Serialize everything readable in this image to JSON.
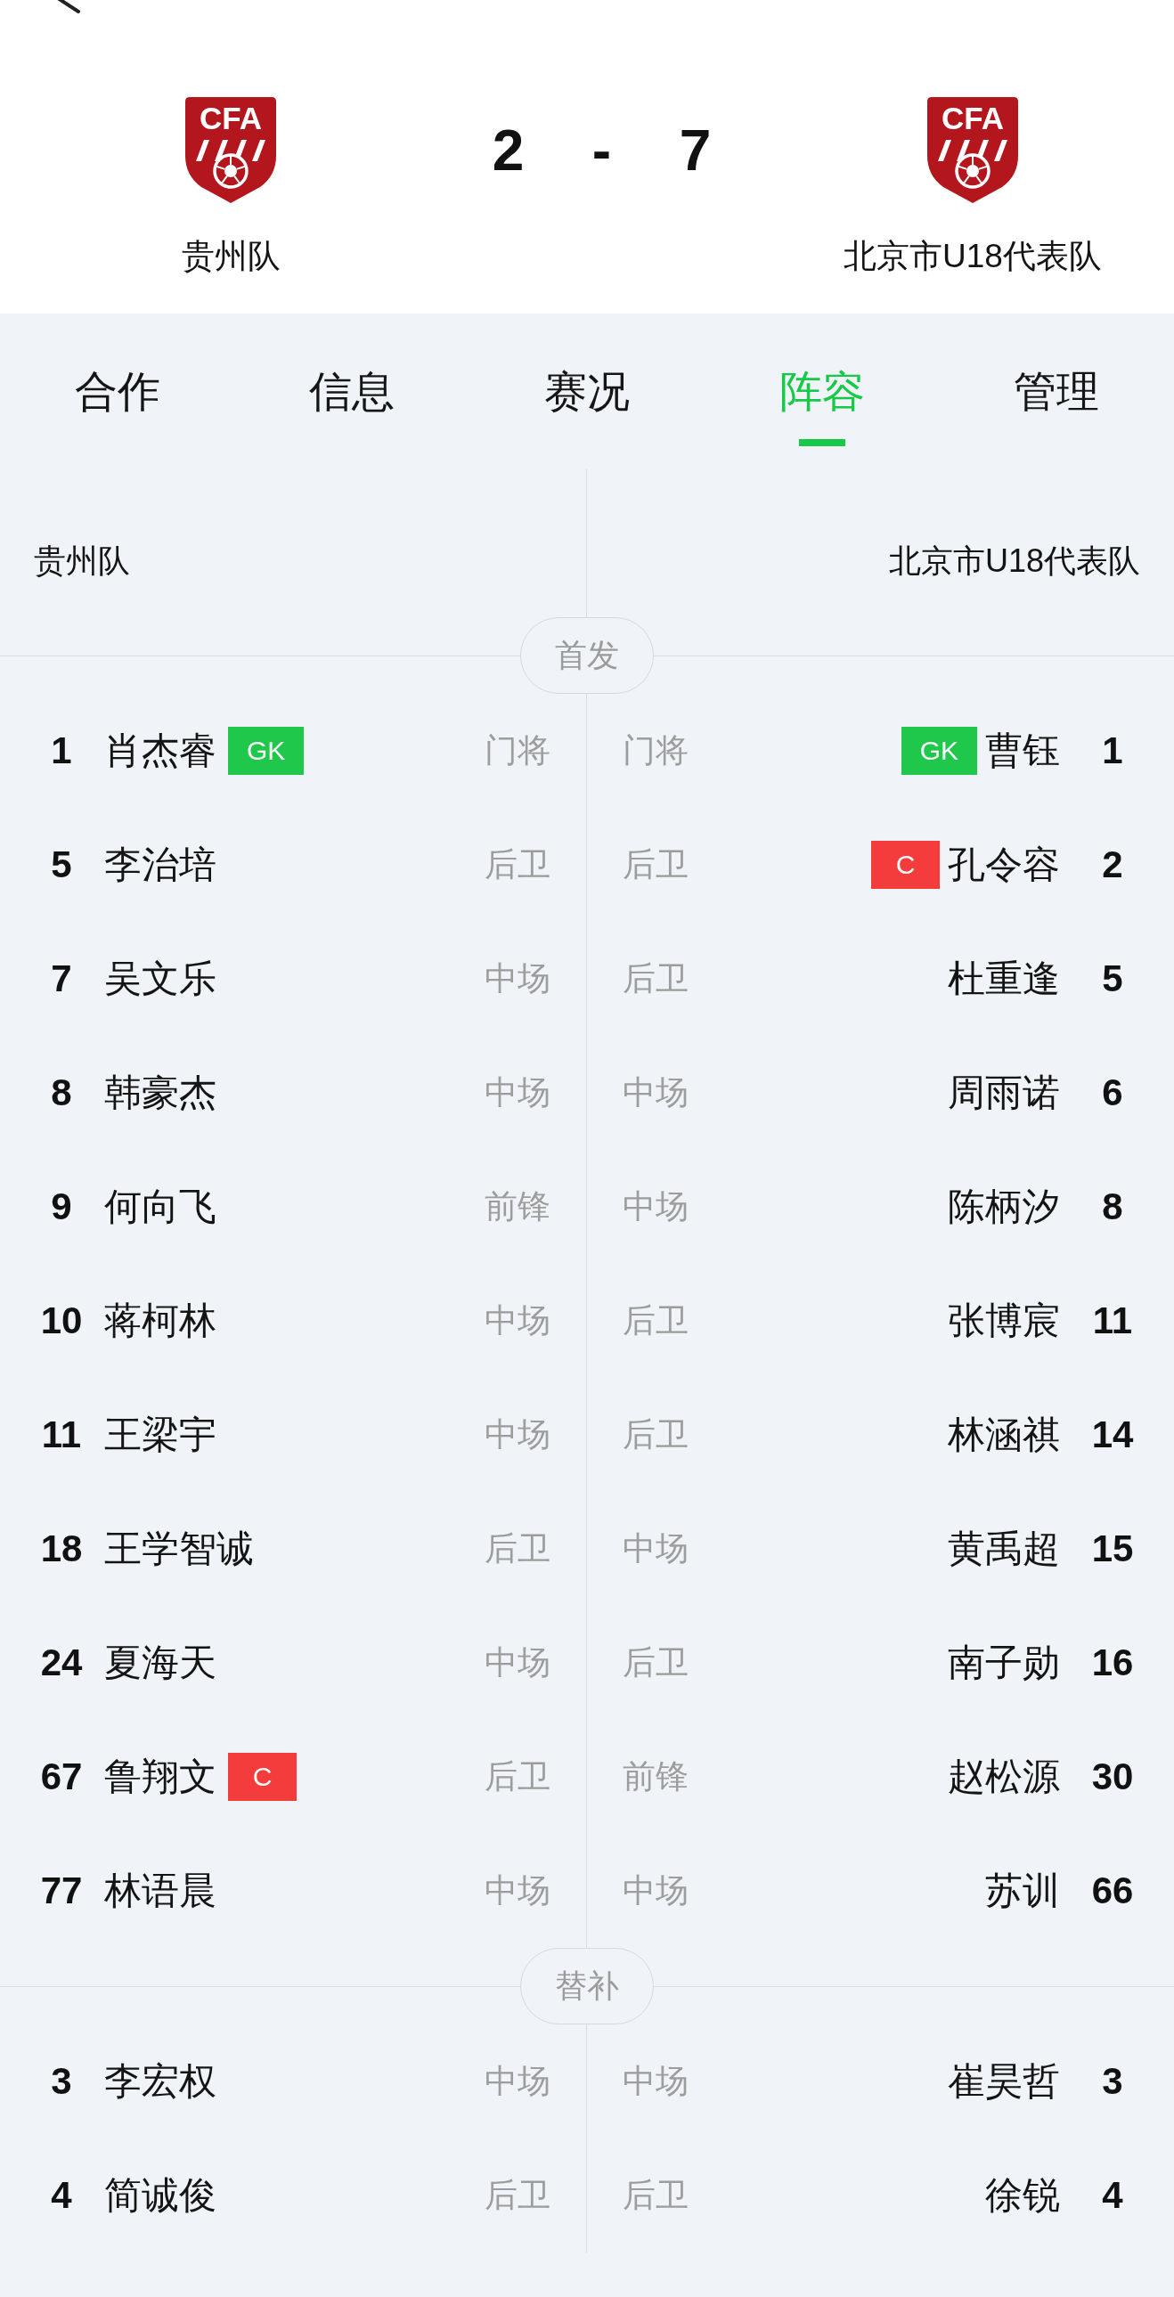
{
  "match": {
    "home": {
      "logo_text": "CFA",
      "name": "贵州队",
      "score": "2"
    },
    "separator": "-",
    "away": {
      "logo_text": "CFA",
      "name": "北京市U18代表队",
      "score": "7"
    }
  },
  "tabs": [
    {
      "label": "合作",
      "selected": false
    },
    {
      "label": "信息",
      "selected": false
    },
    {
      "label": "赛况",
      "selected": false
    },
    {
      "label": "阵容",
      "selected": true
    },
    {
      "label": "管理",
      "selected": false
    }
  ],
  "lineup": {
    "home_team": "贵州队",
    "away_team": "北京市U18代表队",
    "sections": [
      {
        "title": "首发",
        "rows": [
          {
            "home": {
              "number": "1",
              "name": "肖杰睿",
              "badge": {
                "kind": "goalkeeper",
                "label": "GK"
              },
              "position": "门将"
            },
            "away": {
              "position": "门将",
              "badge": {
                "kind": "goalkeeper",
                "label": "GK"
              },
              "name": "曹钰",
              "number": "1"
            }
          },
          {
            "home": {
              "number": "5",
              "name": "李治培",
              "position": "后卫"
            },
            "away": {
              "position": "后卫",
              "badge": {
                "kind": "captain",
                "label": "C"
              },
              "name": "孔令容",
              "number": "2"
            }
          },
          {
            "home": {
              "number": "7",
              "name": "吴文乐",
              "position": "中场"
            },
            "away": {
              "position": "后卫",
              "name": "杜重逢",
              "number": "5"
            }
          },
          {
            "home": {
              "number": "8",
              "name": "韩豪杰",
              "position": "中场"
            },
            "away": {
              "position": "中场",
              "name": "周雨诺",
              "number": "6"
            }
          },
          {
            "home": {
              "number": "9",
              "name": "何向飞",
              "position": "前锋"
            },
            "away": {
              "position": "中场",
              "name": "陈柄汐",
              "number": "8"
            }
          },
          {
            "home": {
              "number": "10",
              "name": "蒋柯林",
              "position": "中场"
            },
            "away": {
              "position": "后卫",
              "name": "张博宸",
              "number": "11"
            }
          },
          {
            "home": {
              "number": "11",
              "name": "王梁宇",
              "position": "中场"
            },
            "away": {
              "position": "后卫",
              "name": "林涵祺",
              "number": "14"
            }
          },
          {
            "home": {
              "number": "18",
              "name": "王学智诚",
              "position": "后卫"
            },
            "away": {
              "position": "中场",
              "name": "黄禹超",
              "number": "15"
            }
          },
          {
            "home": {
              "number": "24",
              "name": "夏海天",
              "position": "中场"
            },
            "away": {
              "position": "后卫",
              "name": "南子勋",
              "number": "16"
            }
          },
          {
            "home": {
              "number": "67",
              "name": "鲁翔文",
              "badge": {
                "kind": "captain",
                "label": "C"
              },
              "position": "后卫"
            },
            "away": {
              "position": "前锋",
              "name": "赵松源",
              "number": "30"
            }
          },
          {
            "home": {
              "number": "77",
              "name": "林语晨",
              "position": "中场"
            },
            "away": {
              "position": "中场",
              "name": "苏训",
              "number": "66"
            }
          }
        ]
      },
      {
        "title": "替补",
        "rows": [
          {
            "home": {
              "number": "3",
              "name": "李宏权",
              "position": "中场"
            },
            "away": {
              "position": "中场",
              "name": "崔昊哲",
              "number": "3"
            }
          },
          {
            "home": {
              "number": "4",
              "name": "简诚俊",
              "position": "后卫"
            },
            "away": {
              "position": "后卫",
              "name": "徐锐",
              "number": "4"
            }
          }
        ]
      }
    ]
  }
}
